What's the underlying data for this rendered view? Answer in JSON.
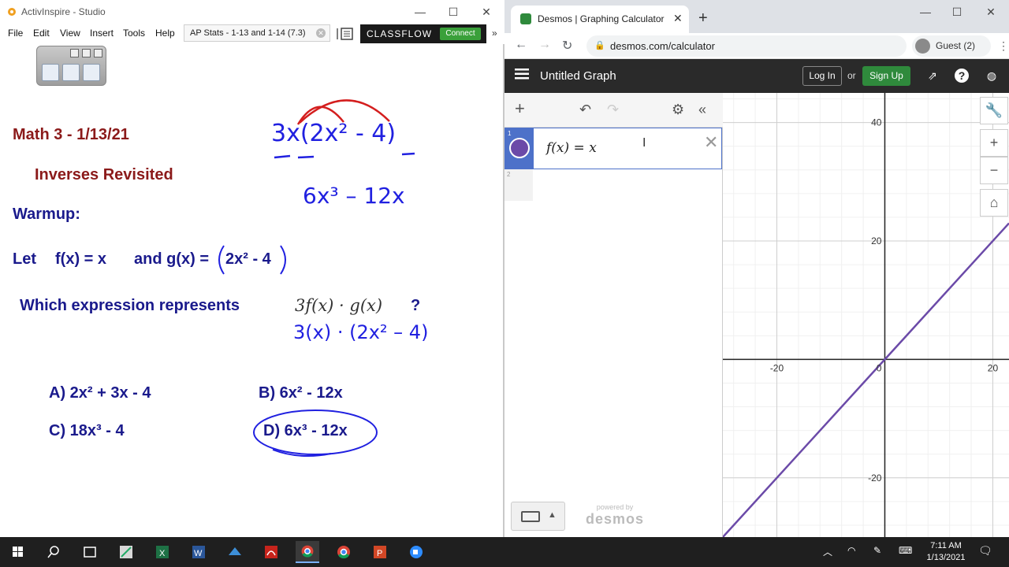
{
  "activinspire": {
    "title": "ActivInspire - Studio",
    "menu": [
      "File",
      "Edit",
      "View",
      "Insert",
      "Tools",
      "Help"
    ],
    "tab_label": "AP Stats - 1-13 and 1-14 (7.3)",
    "classflow": {
      "brand": "CLASSFLOW",
      "connect": "Connect"
    },
    "flipchart": {
      "heading": "Math 3 - 1/13/21",
      "subheading": "Inverses Revisited",
      "warmup": "Warmup:",
      "let_label": "Let",
      "f_def": "f(x) = x",
      "and_label": "and g(x) =",
      "g_def": "2x² - 4",
      "question": "Which expression represents",
      "expression": "3f(x) · g(x)",
      "question_mark": "?",
      "options": {
        "a": "A) 2x² + 3x - 4",
        "b": "B) 6x² - 12x",
        "c": "C) 18x³ - 4",
        "d": "D) 6x³ - 12x"
      },
      "annotations": {
        "work_line_1": "3x(2x² - 4)",
        "work_line_2": "6x³ – 12x",
        "work_line_3": "3(x) · (2x² – 4)"
      }
    }
  },
  "chrome": {
    "tab_title": "Desmos | Graphing Calculator",
    "url": "desmos.com/calculator",
    "profile": "Guest (2)"
  },
  "desmos": {
    "graph_title": "Untitled Graph",
    "login": "Log In",
    "or": "or",
    "signup": "Sign Up",
    "expressions": [
      {
        "index": "1",
        "latex": "f(x) = x",
        "color": "#6b4aa8"
      },
      {
        "index": "2",
        "latex": ""
      }
    ],
    "powered_by": "powered by",
    "brand": "desmos"
  },
  "chart_data": {
    "type": "line",
    "title": "",
    "xlabel": "",
    "ylabel": "",
    "xlim": [
      -30,
      23
    ],
    "ylim": [
      -30,
      45
    ],
    "x_ticks": [
      -20,
      20
    ],
    "y_ticks": [
      40,
      20,
      -20
    ],
    "x_tick_labels": [
      "-20",
      "20"
    ],
    "y_tick_labels": [
      "40",
      "20",
      "-20"
    ],
    "origin_label": "0",
    "grid": true,
    "series": [
      {
        "x": [
          -30,
          23
        ],
        "y": [
          -30,
          23
        ],
        "color": "#6b4aa8"
      }
    ]
  },
  "taskbar": {
    "time": "7:11 AM",
    "date": "1/13/2021"
  }
}
